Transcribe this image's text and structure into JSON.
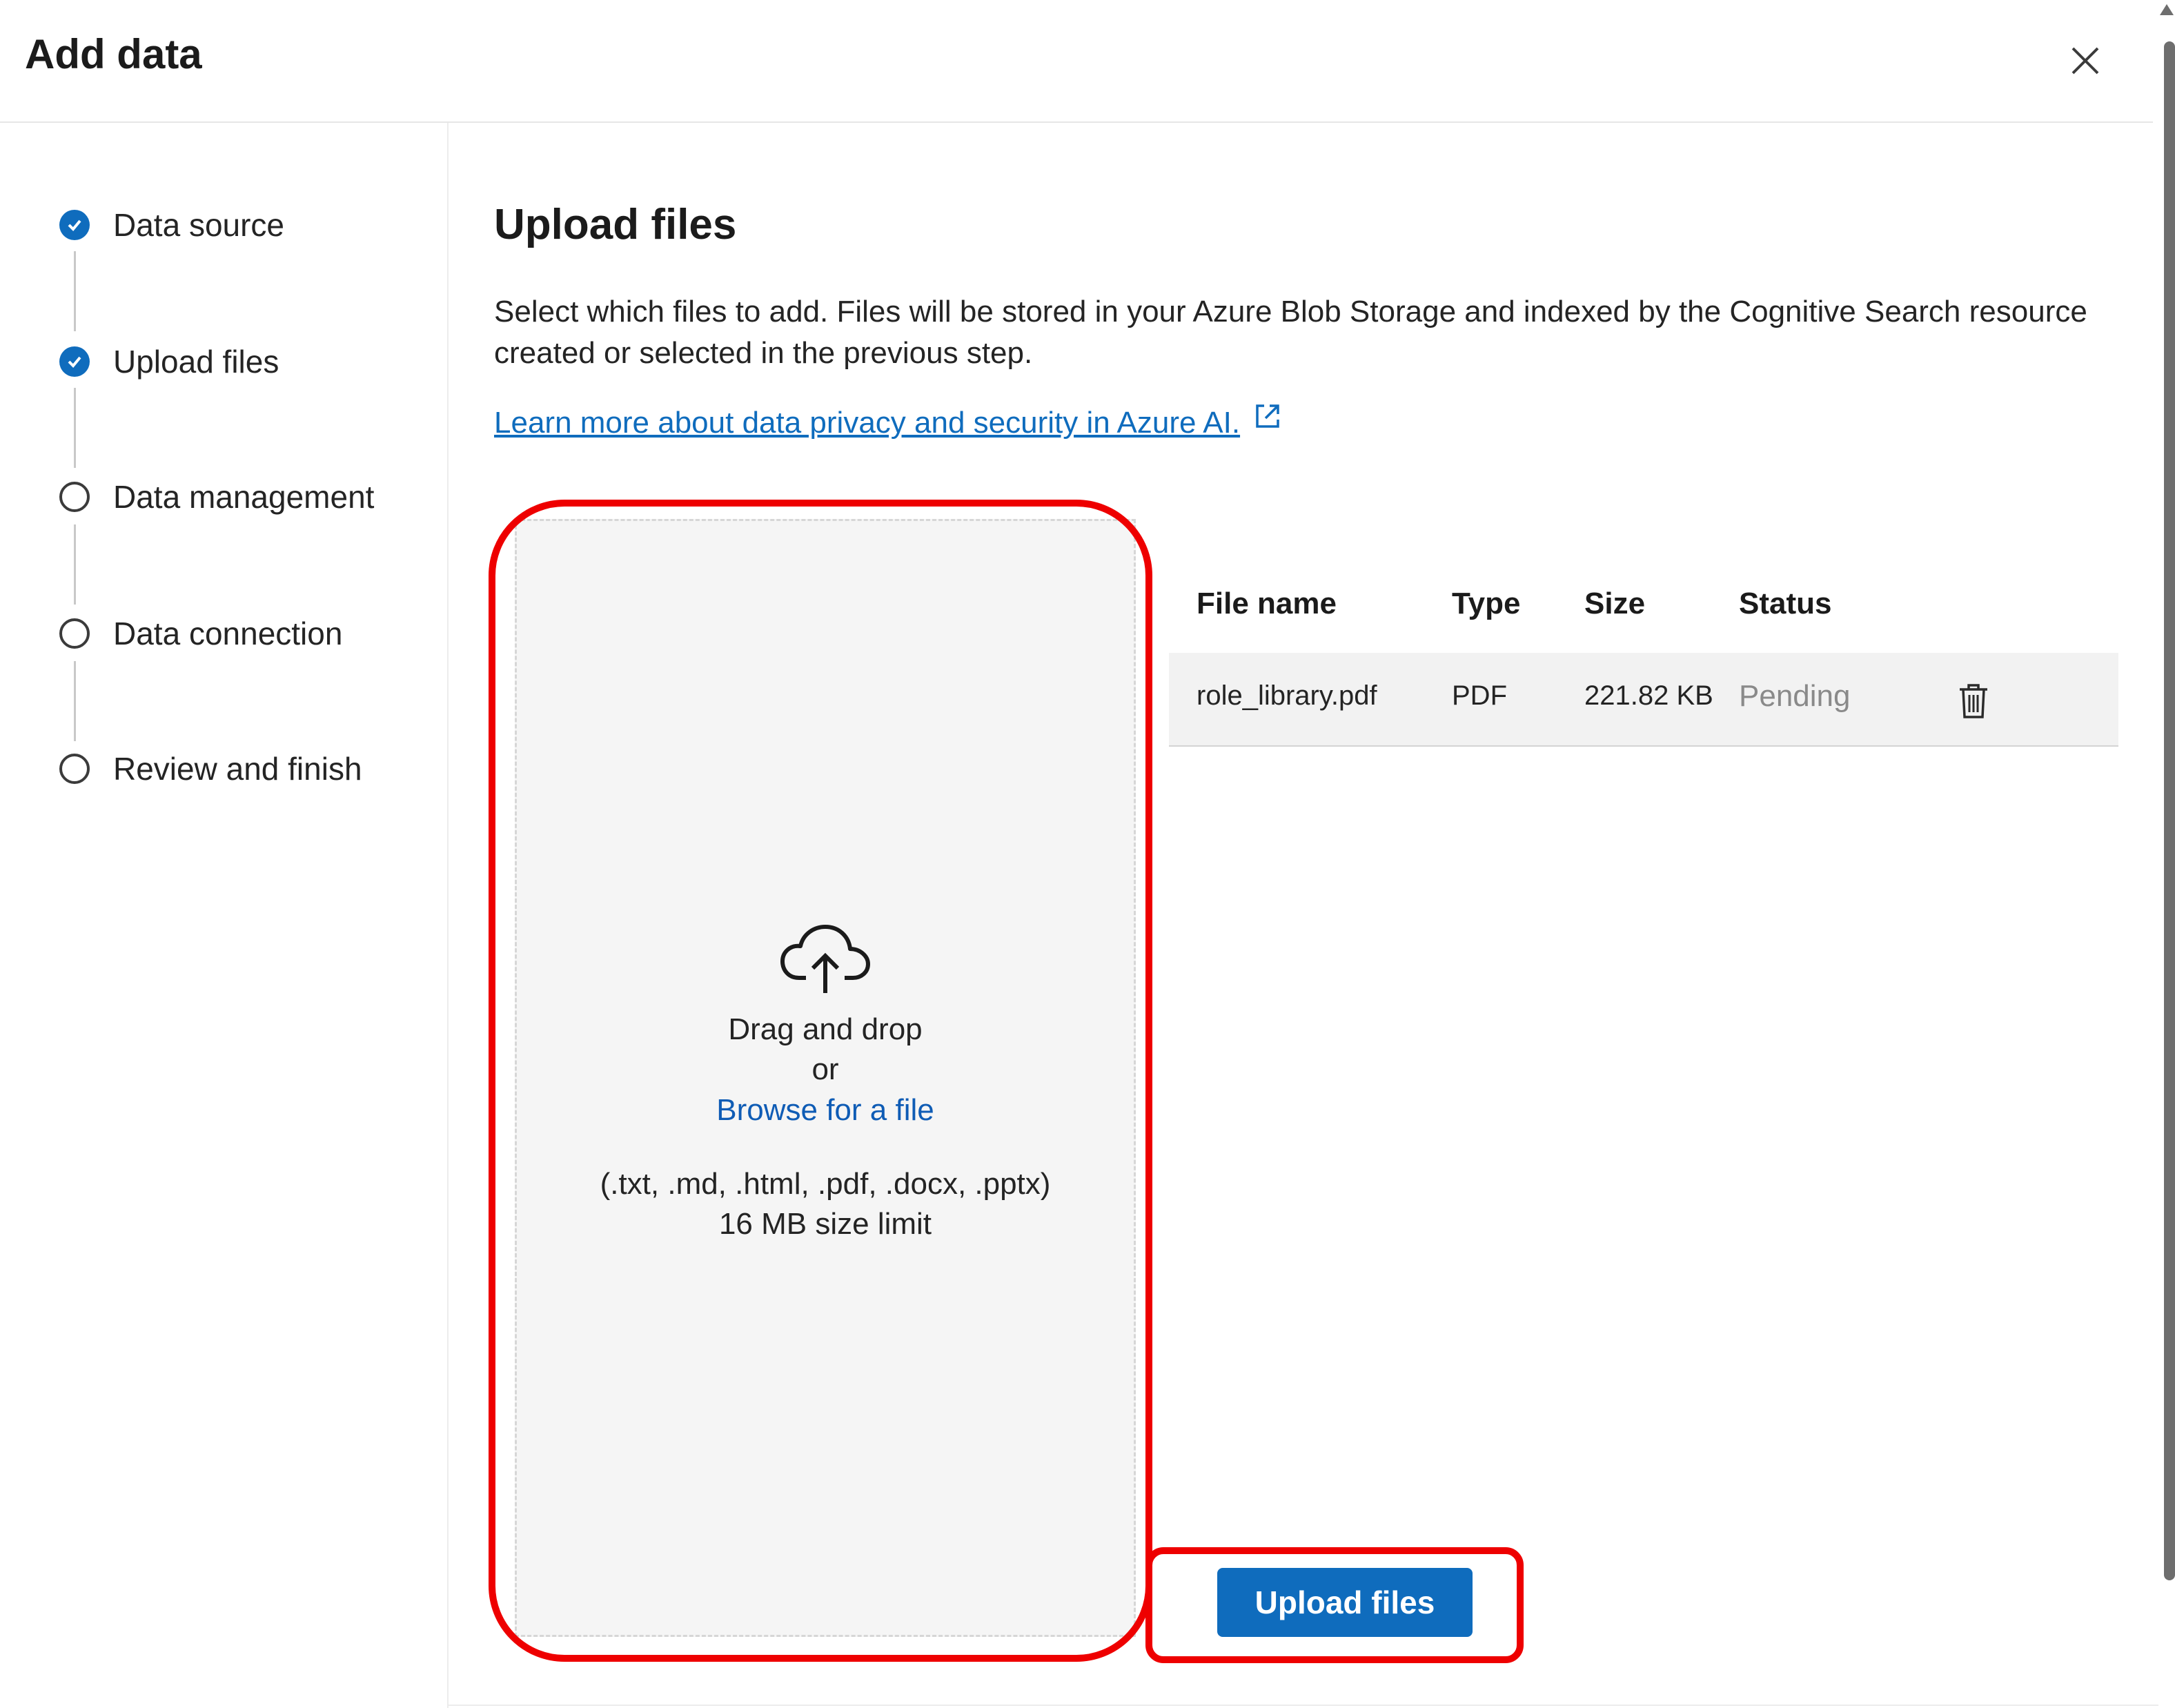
{
  "dialog": {
    "title": "Add data",
    "close_icon": "close-icon"
  },
  "steps": [
    {
      "label": "Data source",
      "state": "done"
    },
    {
      "label": "Upload files",
      "state": "done"
    },
    {
      "label": "Data management",
      "state": "todo"
    },
    {
      "label": "Data connection",
      "state": "todo"
    },
    {
      "label": "Review and finish",
      "state": "todo"
    }
  ],
  "main": {
    "title": "Upload files",
    "description": "Select which files to add. Files will be stored in your Azure Blob Storage and indexed by the Cognitive Search resource created or selected in the previous step.",
    "learn_more": "Learn more about data privacy and security in Azure AI."
  },
  "dropzone": {
    "line1": "Drag and drop",
    "line2": "or",
    "browse": "Browse for a file",
    "types": "(.txt, .md, .html, .pdf, .docx, .pptx)",
    "limit": "16 MB size limit"
  },
  "table": {
    "headers": [
      "File name",
      "Type",
      "Size",
      "Status"
    ],
    "rows": [
      {
        "name": "role_library.pdf",
        "type": "PDF",
        "size": "221.82 KB",
        "status": "Pending"
      }
    ]
  },
  "actions": {
    "upload_label": "Upload files"
  },
  "colors": {
    "accent": "#0f6cbd",
    "highlight": "#ee0000"
  }
}
